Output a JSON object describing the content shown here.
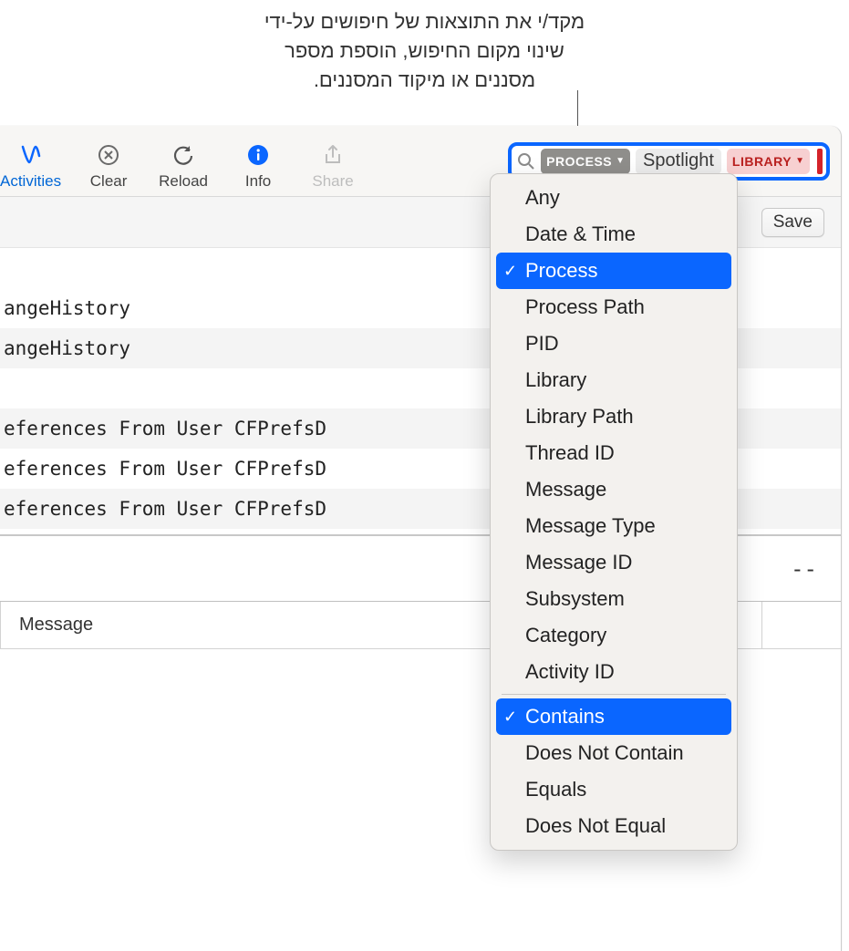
{
  "annotation": {
    "line1": "מקד/י את התוצאות של חיפושים על-ידי",
    "line2": "שינוי מקום החיפוש, הוספת מספר",
    "line3": "מסננים או מיקוד המסננים."
  },
  "toolbar": {
    "activities": "Activities",
    "clear": "Clear",
    "reload": "Reload",
    "info": "Info",
    "share": "Share"
  },
  "search": {
    "token1_label": "PROCESS",
    "token1_value": "Spotlight",
    "token2_label": "LIBRARY"
  },
  "subbar": {
    "save": "Save"
  },
  "rows": [
    "angeHistory",
    "angeHistory",
    "eferences From User CFPrefsD",
    "eferences From User CFPrefsD",
    "eferences From User CFPrefsD"
  ],
  "detail": {
    "dashes": "--"
  },
  "cols": {
    "message": "Message"
  },
  "dropdown": {
    "types": [
      "Any",
      "Date & Time",
      "Process",
      "Process Path",
      "PID",
      "Library",
      "Library Path",
      "Thread ID",
      "Message",
      "Message Type",
      "Message ID",
      "Subsystem",
      "Category",
      "Activity ID"
    ],
    "selected_type": "Process",
    "ops": [
      "Contains",
      "Does Not Contain",
      "Equals",
      "Does Not Equal"
    ],
    "selected_op": "Contains"
  }
}
